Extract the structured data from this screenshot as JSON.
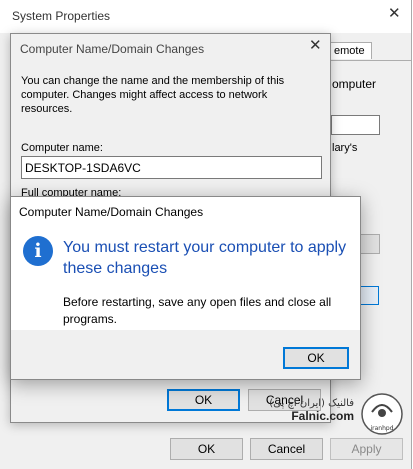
{
  "sysprop": {
    "title": "System Properties",
    "close_glyph": "✕",
    "tab_remote": "emote",
    "side_text_1": "omputer",
    "side_text_2": "lary's",
    "ok_label": "OK",
    "cancel_label": "Cancel",
    "apply_label": "Apply"
  },
  "namechange": {
    "title": "Computer Name/Domain Changes",
    "close_glyph": "✕",
    "description": "You can change the name and the membership of this computer. Changes might affect access to network resources.",
    "computer_name_label": "Computer name:",
    "computer_name_value": "DESKTOP-1SDA6VC",
    "full_name_label": "Full computer name:",
    "ok_label": "OK",
    "cancel_label": "Cancel"
  },
  "restart": {
    "title": "Computer Name/Domain Changes",
    "icon": "info-icon",
    "icon_glyph": "i",
    "heading": "You must restart your computer to apply these changes",
    "body": "Before restarting, save any open files and close all programs.",
    "ok_label": "OK"
  },
  "watermark": {
    "name_fa": "فالنیک (ایران اچ پی)",
    "site": "Falnic.com",
    "logo_text": "iranhpd"
  },
  "colors": {
    "accent": "#0078d7",
    "heading_blue": "#1a4fb4",
    "info_icon": "#1f6fd0"
  }
}
